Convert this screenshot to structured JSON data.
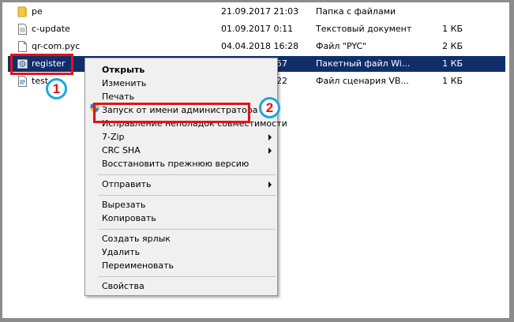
{
  "files": [
    {
      "name": "pe",
      "date": "21.09.2017 21:03",
      "type": "Папка с файлами",
      "size": "",
      "icon": "folder-icon"
    },
    {
      "name": "c-update",
      "date": "01.09.2017 0:11",
      "type": "Текстовый документ",
      "size": "1 КБ",
      "icon": "text-file-icon"
    },
    {
      "name": "qr-com.pyc",
      "date": "04.04.2018 16:28",
      "type": "Файл \"PYC\"",
      "size": "2 КБ",
      "icon": "file-icon"
    },
    {
      "name": "register",
      "date": "57",
      "type": "Пакетный файл Wi...",
      "size": "1 КБ",
      "icon": "batch-file-icon"
    },
    {
      "name": "test",
      "date": "22",
      "type": "Файл сценария VB...",
      "size": "1 КБ",
      "icon": "script-file-icon"
    }
  ],
  "context_menu": {
    "open": "Открыть",
    "edit": "Изменить",
    "print": "Печать",
    "run_as_admin": "Запуск от имени администратора",
    "troubleshoot": "Исправление неполадок совместимости",
    "zip": "7-Zip",
    "crc": "CRC SHA",
    "restore": "Восстановить прежнюю версию",
    "send_to": "Отправить",
    "cut": "Вырезать",
    "copy": "Копировать",
    "shortcut": "Создать ярлык",
    "delete": "Удалить",
    "rename": "Переименовать",
    "properties": "Свойства"
  },
  "annotations": {
    "step1": "1",
    "step2": "2"
  },
  "colors": {
    "selection": "#102f6a",
    "highlight_box": "#e21318",
    "badge_border": "#1ea6dc"
  }
}
